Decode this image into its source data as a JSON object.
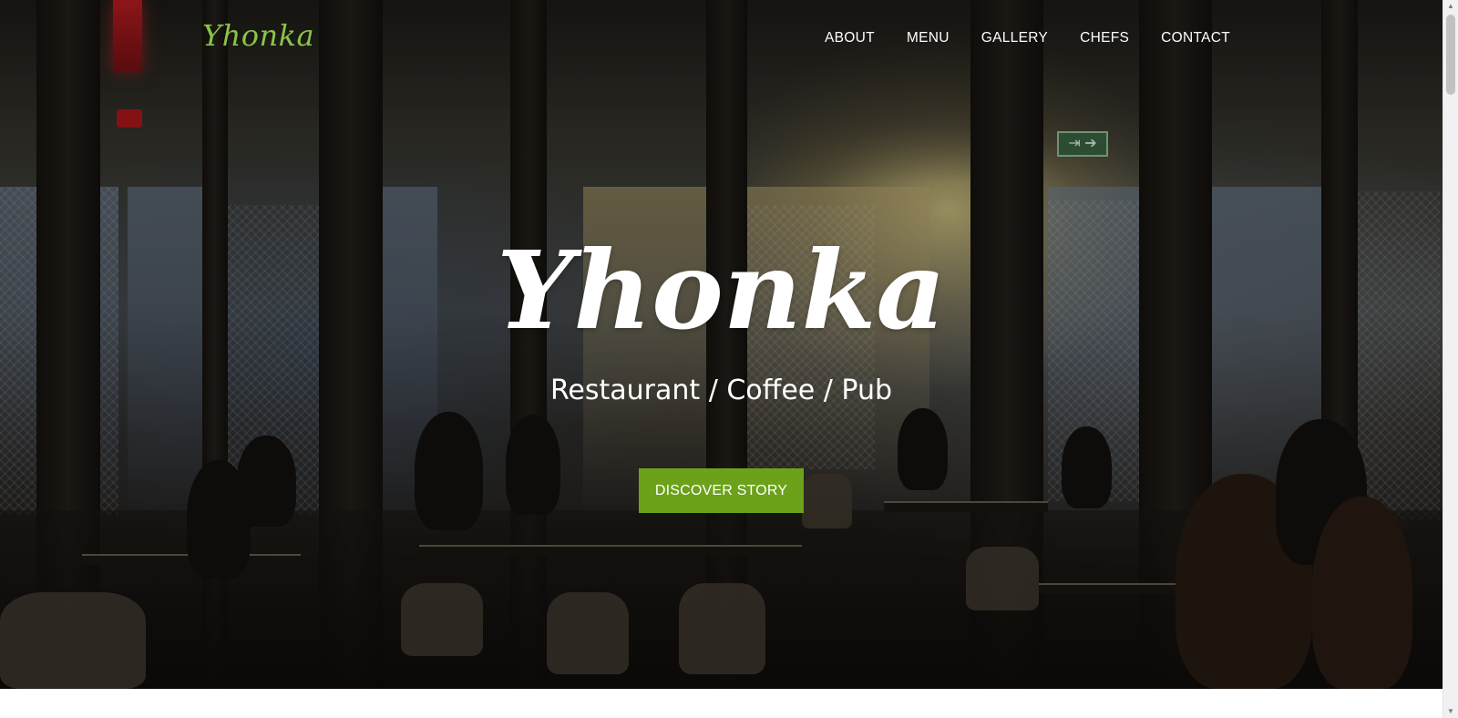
{
  "navbar": {
    "brand": "Yhonka",
    "items": [
      {
        "label": "ABOUT"
      },
      {
        "label": "MENU"
      },
      {
        "label": "GALLERY"
      },
      {
        "label": "CHEFS"
      },
      {
        "label": "CONTACT"
      }
    ]
  },
  "hero": {
    "title": "Yhonka",
    "subtitle": "Restaurant / Coffee / Pub",
    "cta_label": "DISCOVER STORY",
    "exit_sign": "⇥ ➔"
  },
  "colors": {
    "accent": "#6ca21a",
    "brand": "#8bc34a",
    "text_light": "#ffffff",
    "page_bg": "#ffffff"
  },
  "icons": {
    "scroll_up": "arrow-up-icon",
    "scroll_down": "arrow-down-icon"
  }
}
